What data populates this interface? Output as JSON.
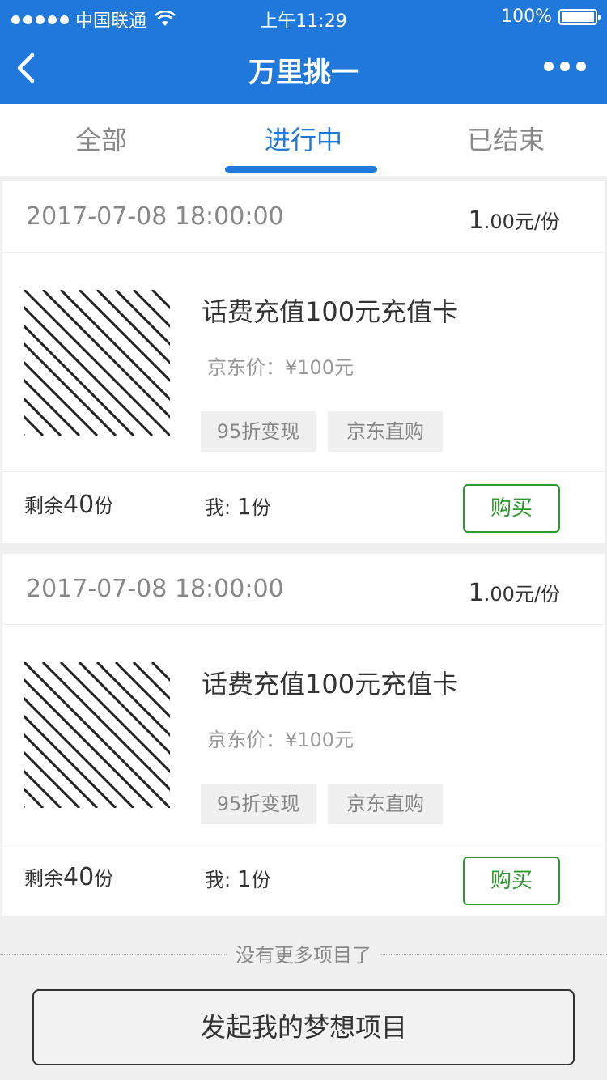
{
  "status_bar": {
    "carrier": "中国联通",
    "time": "上午11:29",
    "battery": "100%"
  },
  "nav": {
    "title": "万里挑一"
  },
  "tabs": [
    {
      "label": "全部"
    },
    {
      "label": "进行中"
    },
    {
      "label": "已结束"
    }
  ],
  "items": [
    {
      "date": "2017-07-08 18:00:00",
      "price_big": "1",
      "price_small": ".00元/份",
      "name": "话费充值100元充值卡",
      "jd_price": "京东价：¥100元",
      "tags": [
        "95折变现",
        "京东直购"
      ],
      "remain_prefix": "剩余",
      "remain_count": "40",
      "remain_suffix": "份",
      "mine_prefix": "我: ",
      "mine_count": "1",
      "mine_suffix": "份",
      "buy_label": "购买"
    },
    {
      "date": "2017-07-08 18:00:00",
      "price_big": "1",
      "price_small": ".00元/份",
      "name": "话费充值100元充值卡",
      "jd_price": "京东价：¥100元",
      "tags": [
        "95折变现",
        "京东直购"
      ],
      "remain_prefix": "剩余",
      "remain_count": "40",
      "remain_suffix": "份",
      "mine_prefix": "我: ",
      "mine_count": "1",
      "mine_suffix": "份",
      "buy_label": "购买"
    }
  ],
  "footer": {
    "no_more": "没有更多项目了",
    "launch_label": "发起我的梦想项目"
  }
}
